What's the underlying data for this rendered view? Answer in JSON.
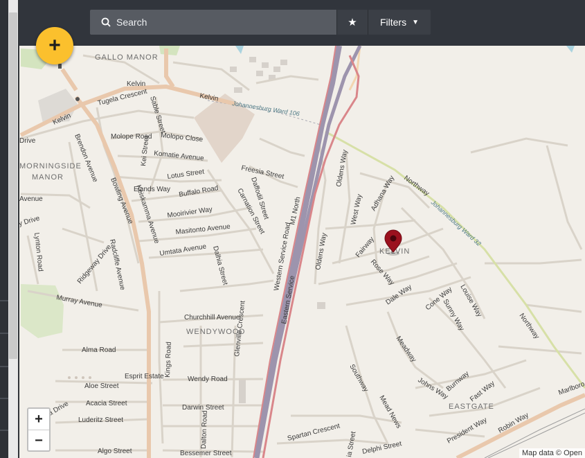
{
  "search": {
    "placeholder": "Search",
    "icon": "search-icon"
  },
  "favorites_icon": "star-icon",
  "filters": {
    "label": "Filters",
    "icon": "chevron-down-icon"
  },
  "add_button": {
    "icon": "plus-icon",
    "color": "#fbc02d"
  },
  "zoom": {
    "in": "+",
    "out": "−"
  },
  "attribution": "Map data © Open",
  "marker": {
    "icon": "map-pin-icon",
    "color": "#9b111e"
  },
  "map": {
    "areas": [
      "GALLO MANOR",
      "MORNINGSIDE",
      "MANOR",
      "KELVIN",
      "WENDYWOOD",
      "EASTGATE"
    ],
    "wards": [
      "Johannesburg Ward 106",
      "Johannesburg Ward 32"
    ],
    "roads": [
      "Kelvin",
      "Kelvin",
      "Kelvin",
      "Tugela Crescent",
      "Sable Street",
      "Molope Road",
      "Molopo Close",
      "Komatie Avenue",
      "Kei Street",
      "Brendon Avenue",
      "Lotus Street",
      "Freesia Street",
      "Daffodil Street",
      "Elands Way",
      "Buffalo Road",
      "Carnation Street",
      "Bowling Avenue",
      "Keiskamma Avenue",
      "Mooirivier Way",
      "Masitonto Avenue",
      "Umtata Avenue",
      "Dalhia Street",
      "Lynton Road",
      "Radcliffe Avenue",
      "Ridgeway Drive",
      "Murray Avenue",
      "Churchhill Avenue",
      "Glenville Crescent",
      "Alma Road",
      "Kings Road",
      "Wendy Road",
      "Esprit Estate",
      "Aloe Street",
      "Acacia Street",
      "Darwin Street",
      "Luderitz Street",
      "Dalton Road",
      "Algo Street",
      "Bessemer Street",
      "Western Service Road",
      "Eastern Service",
      "M1 North",
      "Oldens Way",
      "Oldens Way",
      "West Way",
      "Adhana Way",
      "Northway",
      "Northway",
      "Fairway",
      "Rose Way",
      "Dale Way",
      "Cone Way",
      "Sunny Way",
      "Louise Way",
      "Meadway",
      "Southway",
      "Mead News",
      "Johns Way",
      "Burnway",
      "Fast Way",
      "President Way",
      "Robin Way",
      "Spartan Crescent",
      "Delphi Street",
      "Marlboro",
      "Drive",
      "Avenue",
      "y Drive",
      "a Drive",
      "ia Street"
    ]
  }
}
